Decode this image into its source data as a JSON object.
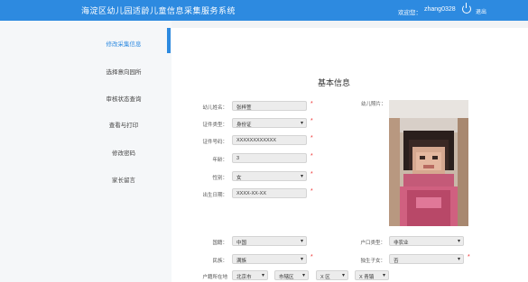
{
  "header": {
    "title": "海淀区幼儿园适龄儿童信息采集服务系统",
    "welcome": "欢迎您：",
    "username": "zhang0328",
    "logout": "退出",
    "color": "#2d8ae0"
  },
  "sidebar": {
    "items": [
      {
        "label": "修改采集信息",
        "active": true
      },
      {
        "label": "选择意向园所",
        "active": false
      },
      {
        "label": "审核状态查询",
        "active": false
      },
      {
        "label": "查看与打印",
        "active": false
      },
      {
        "label": "修改密码",
        "active": false
      },
      {
        "label": "家长留言",
        "active": false
      }
    ]
  },
  "form": {
    "section_title": "基本信息",
    "fields": {
      "name": {
        "label": "幼儿姓名：",
        "value": "张梓萱"
      },
      "id_type": {
        "label": "证件类型：",
        "value": "身份证"
      },
      "id_number": {
        "label": "证件号码：",
        "value": "XXXXXXXXXXXX"
      },
      "age": {
        "label": "年龄：",
        "value": "3"
      },
      "gender": {
        "label": "性别：",
        "value": "女"
      },
      "birthdate": {
        "label": "出生日期：",
        "value": "XXXX-XX-XX"
      },
      "nationality": {
        "label": "国籍：",
        "value": "中国"
      },
      "ethnicity": {
        "label": "民族：",
        "value": "满族"
      },
      "hukou_type": {
        "label": "户口类型：",
        "value": "非农业"
      },
      "only_child": {
        "label": "独生子女：",
        "value": "否"
      },
      "hukou_location": {
        "label": "户籍所在地",
        "province": "北京市",
        "district": "市辖区",
        "county": "X 区",
        "street": "X 青镇"
      }
    },
    "photo_label": "幼儿照片："
  }
}
